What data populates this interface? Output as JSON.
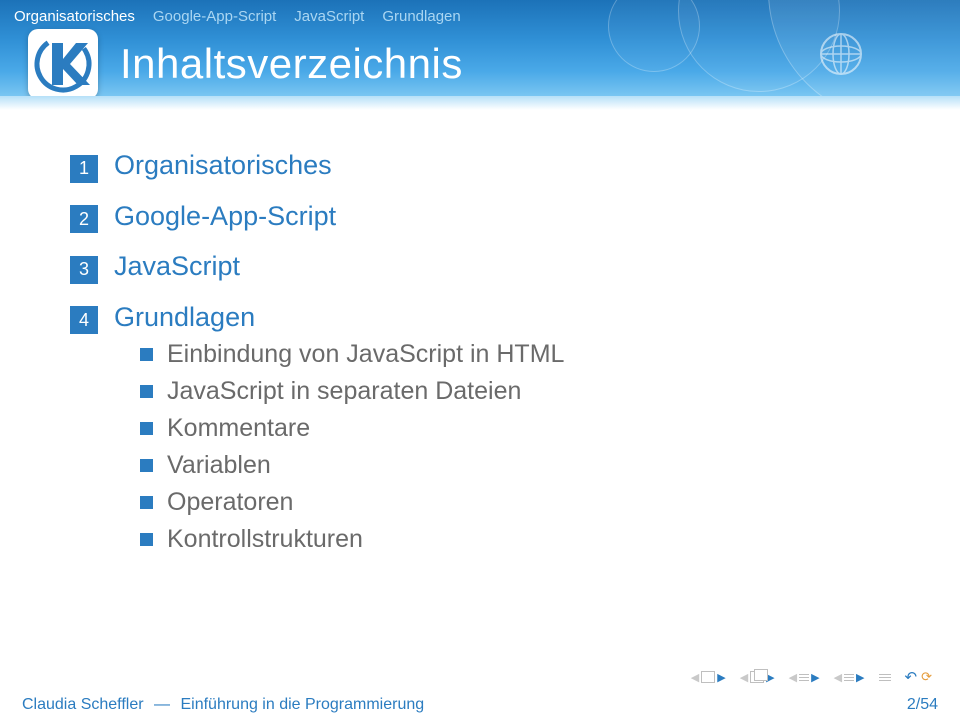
{
  "nav": {
    "items": [
      {
        "label": "Organisatorisches",
        "current": true
      },
      {
        "label": "Google-App-Script",
        "current": false
      },
      {
        "label": "JavaScript",
        "current": false
      },
      {
        "label": "Grundlagen",
        "current": false
      }
    ]
  },
  "title": "Inhaltsverzeichnis",
  "toc": [
    {
      "num": "1",
      "label": "Organisatorisches",
      "sub": []
    },
    {
      "num": "2",
      "label": "Google-App-Script",
      "sub": []
    },
    {
      "num": "3",
      "label": "JavaScript",
      "sub": []
    },
    {
      "num": "4",
      "label": "Grundlagen",
      "sub": [
        "Einbindung von JavaScript in HTML",
        "JavaScript in separaten Dateien",
        "Kommentare",
        "Variablen",
        "Operatoren",
        "Kontrollstrukturen"
      ]
    }
  ],
  "footer": {
    "author": "Claudia Scheffler",
    "sep": "—",
    "course": "Einführung in die Programmierung",
    "page": "2/54"
  },
  "controls": {
    "prev_frame": "prev-frame",
    "next_frame": "next-frame",
    "prev_section": "prev-section",
    "next_section": "next-section",
    "prev_subsection": "prev-subsection",
    "next_subsection": "next-subsection",
    "outline": "outline",
    "undo": "back"
  }
}
